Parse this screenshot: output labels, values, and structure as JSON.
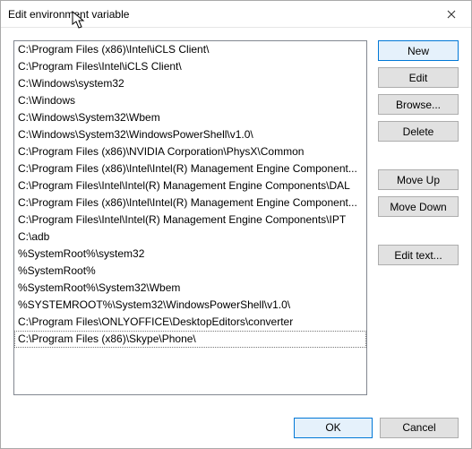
{
  "window": {
    "title": "Edit environment variable"
  },
  "list": {
    "items": [
      "C:\\Program Files (x86)\\Intel\\iCLS Client\\",
      "C:\\Program Files\\Intel\\iCLS Client\\",
      "C:\\Windows\\system32",
      "C:\\Windows",
      "C:\\Windows\\System32\\Wbem",
      "C:\\Windows\\System32\\WindowsPowerShell\\v1.0\\",
      "C:\\Program Files (x86)\\NVIDIA Corporation\\PhysX\\Common",
      "C:\\Program Files (x86)\\Intel\\Intel(R) Management Engine Component...",
      "C:\\Program Files\\Intel\\Intel(R) Management Engine Components\\DAL",
      "C:\\Program Files (x86)\\Intel\\Intel(R) Management Engine Component...",
      "C:\\Program Files\\Intel\\Intel(R) Management Engine Components\\IPT",
      "C:\\adb",
      "%SystemRoot%\\system32",
      "%SystemRoot%",
      "%SystemRoot%\\System32\\Wbem",
      "%SYSTEMROOT%\\System32\\WindowsPowerShell\\v1.0\\",
      "C:\\Program Files\\ONLYOFFICE\\DesktopEditors\\converter",
      "C:\\Program Files (x86)\\Skype\\Phone\\"
    ],
    "editing_index": 17
  },
  "buttons": {
    "new": "New",
    "edit": "Edit",
    "browse": "Browse...",
    "delete": "Delete",
    "move_up": "Move Up",
    "move_down": "Move Down",
    "edit_text": "Edit text...",
    "ok": "OK",
    "cancel": "Cancel"
  }
}
